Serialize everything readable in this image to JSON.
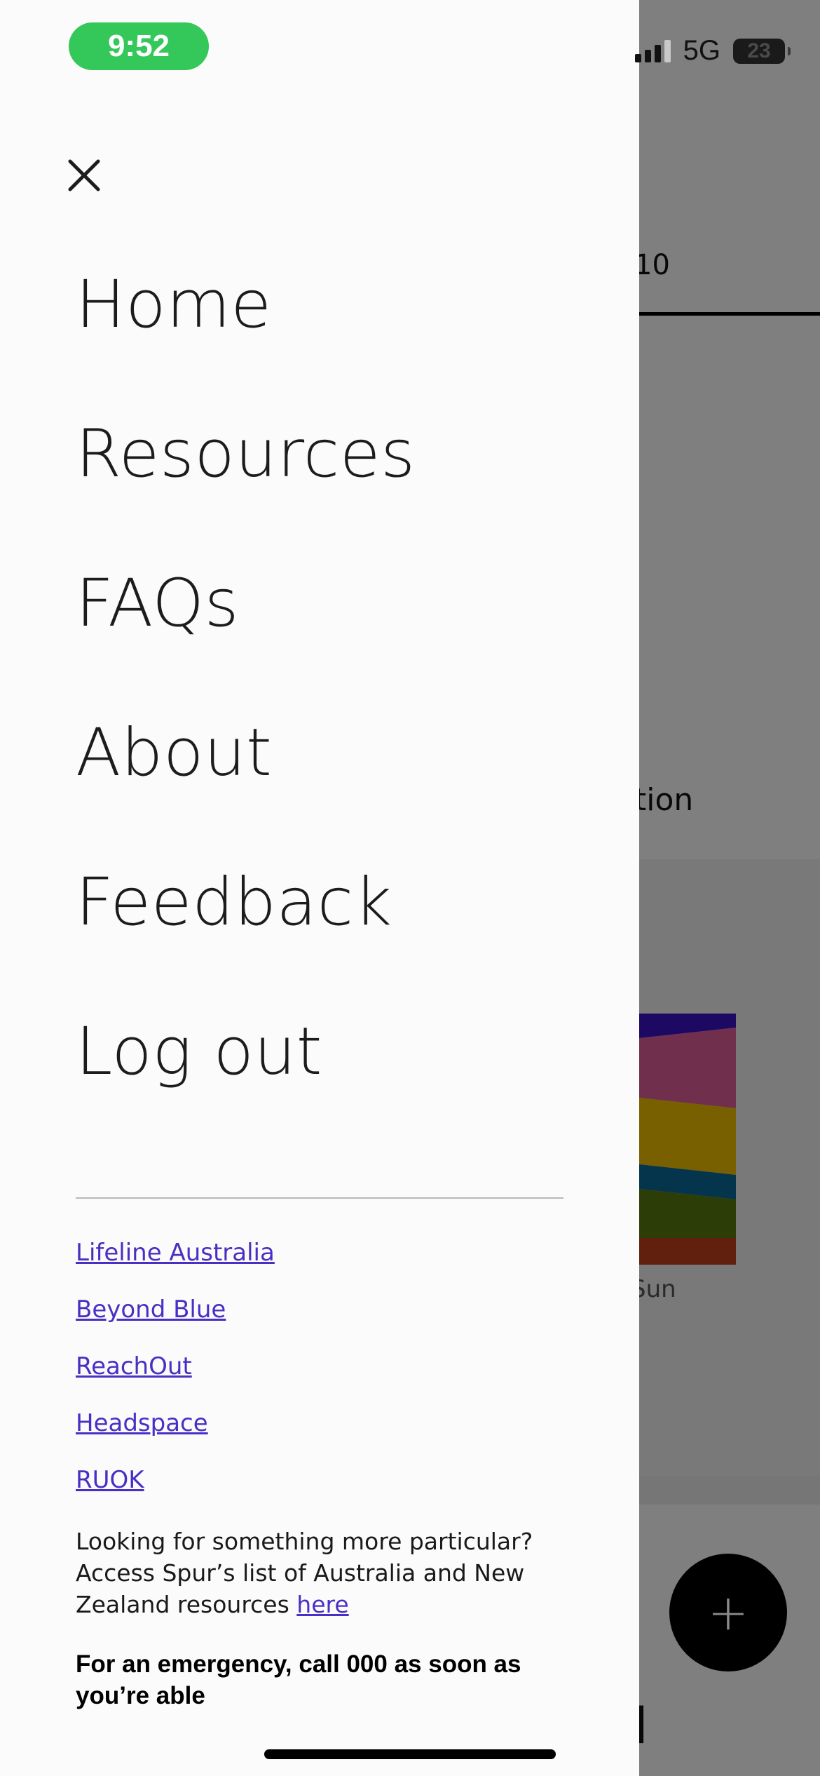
{
  "status_bar": {
    "time": "9:52",
    "network": "5G",
    "battery": "23"
  },
  "drawer": {
    "close_icon": "close-icon",
    "nav_items": [
      {
        "label": "Home"
      },
      {
        "label": "Resources"
      },
      {
        "label": "FAQs"
      },
      {
        "label": "About"
      },
      {
        "label": "Feedback"
      },
      {
        "label": "Log out"
      }
    ],
    "resource_links": [
      {
        "label": "Lifeline Australia"
      },
      {
        "label": "Beyond Blue"
      },
      {
        "label": "ReachOut"
      },
      {
        "label": "Headspace"
      },
      {
        "label": "RUOK"
      }
    ],
    "more_text": "Looking for something more particular? Access Spur’s list of Australia and New Zealand resources ",
    "more_link": "here",
    "emergency_text": "For an emergency, call 000 as soon as you’re able"
  },
  "background": {
    "tab_fragment": "10",
    "section_fragment": "tion",
    "day_fragment": "Sun",
    "bottom_fragment": "d",
    "fab_icon": "plus-icon",
    "fab_label": "+"
  },
  "colors": {
    "status_pill": "#34c759",
    "link": "#4a2fc4",
    "drawer_bg": "#fbfbfb"
  }
}
